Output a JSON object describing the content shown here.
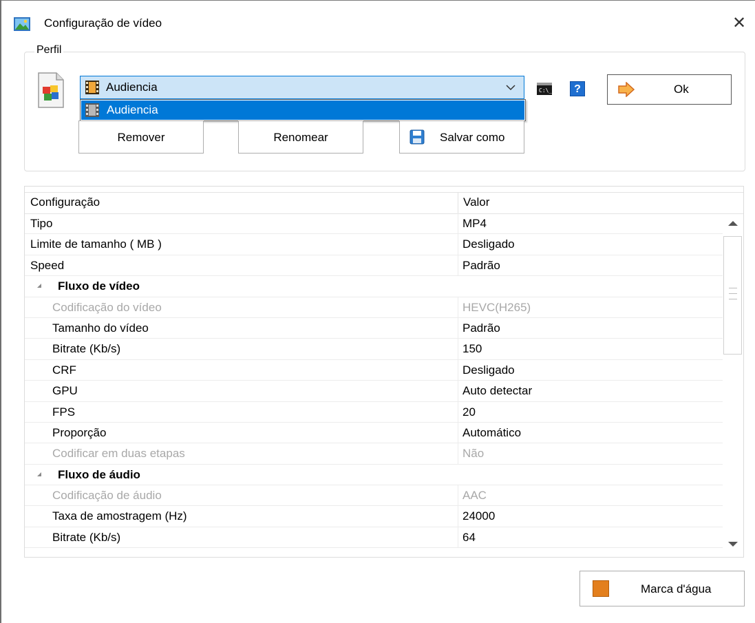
{
  "window": {
    "title": "Configuração de vídeo",
    "close_glyph": "✕"
  },
  "profile_group": {
    "legend": "Perfil",
    "selected": "Audiencia",
    "dropdown_items": [
      "Audiencia"
    ],
    "ok_label": "Ok",
    "help_glyph": "?",
    "remove_label": "Remover",
    "rename_label": "Renomear",
    "save_as_label": "Salvar como"
  },
  "grid": {
    "header": {
      "key": "Configuração",
      "value": "Valor"
    },
    "rows": [
      {
        "k": "Tipo",
        "v": "MP4"
      },
      {
        "k": "Limite de tamanho ( MB )",
        "v": "Desligado"
      },
      {
        "k": "Speed",
        "v": "Padrão"
      },
      {
        "k": "Fluxo de vídeo",
        "v": ""
      },
      {
        "k": "Codificação do vídeo",
        "v": "HEVC(H265)"
      },
      {
        "k": "Tamanho do vídeo",
        "v": "Padrão"
      },
      {
        "k": "Bitrate (Kb/s)",
        "v": "150"
      },
      {
        "k": "CRF",
        "v": "Desligado"
      },
      {
        "k": "GPU",
        "v": "Auto detectar"
      },
      {
        "k": "FPS",
        "v": "20"
      },
      {
        "k": "Proporção",
        "v": "Automático"
      },
      {
        "k": "Codificar em duas etapas",
        "v": "Não"
      },
      {
        "k": "Fluxo de áudio",
        "v": ""
      },
      {
        "k": "Codificação de áudio",
        "v": "AAC"
      },
      {
        "k": "Taxa de amostragem (Hz)",
        "v": "24000"
      },
      {
        "k": "Bitrate (Kb/s)",
        "v": "64"
      }
    ]
  },
  "watermark_label": "Marca d'água",
  "colors": {
    "selection": "#0078d7",
    "combo_bg": "#cce4f7",
    "disabled_text": "#a8a8a8"
  },
  "icons": {
    "app": "image-landscape-icon",
    "profile": "document-cubes-icon",
    "combo": "film-strip-icon",
    "cmd": "command-prompt-icon",
    "help": "help-icon",
    "ok": "arrow-right-icon",
    "save": "floppy-disk-icon",
    "watermark": "watermark-icon"
  }
}
